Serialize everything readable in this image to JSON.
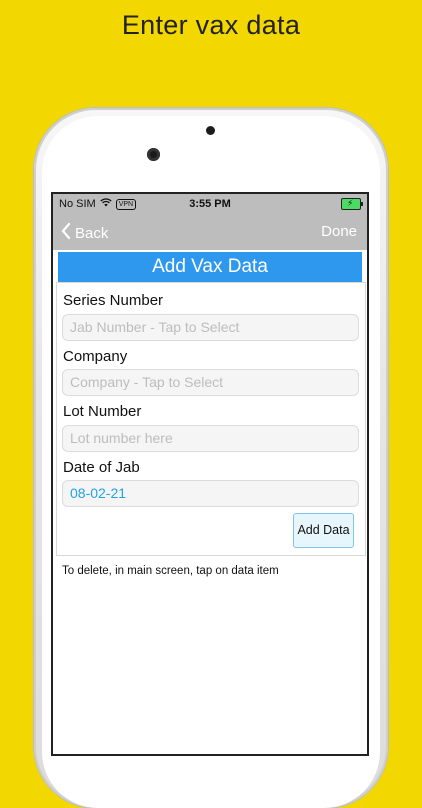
{
  "promo": {
    "headline": "Enter vax data"
  },
  "status_bar": {
    "carrier": "No SIM",
    "vpn": "VPN",
    "time": "3:55 PM",
    "battery_bolt": "⚡"
  },
  "nav": {
    "back_label": "Back",
    "back_chevron": "‹",
    "done_label": "Done"
  },
  "screen": {
    "title": "Add Vax Data"
  },
  "form": {
    "series_label": "Series Number",
    "series_placeholder": "Jab Number - Tap to Select",
    "company_label": "Company",
    "company_placeholder": "Company - Tap to Select",
    "lot_label": "Lot Number",
    "lot_placeholder": "Lot number here",
    "date_label": "Date of Jab",
    "date_value": "08-02-21",
    "add_button": "Add Data"
  },
  "hint": "To delete, in main screen, tap on data item",
  "icons": {
    "wifi": "wifi-icon",
    "battery": "battery-icon",
    "back": "chevron-left-icon"
  },
  "colors": {
    "background": "#f2d800",
    "title_bar": "#2e98ee",
    "nav_bar": "#bdbdbd",
    "date_text": "#1fa3e6",
    "battery": "#4cd964"
  }
}
